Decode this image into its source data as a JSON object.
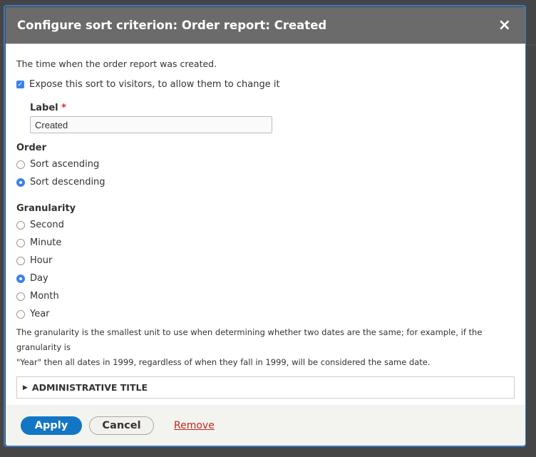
{
  "dialog": {
    "title": "Configure sort criterion: Order report: Created",
    "close_icon": "×",
    "description": "The time when the order report was created.",
    "expose_label": "Expose this sort to visitors, to allow them to change it",
    "expose_checked": true,
    "label_field": {
      "label": "Label",
      "required_mark": "*",
      "value": "Created"
    },
    "order": {
      "label": "Order",
      "options": [
        {
          "label": "Sort ascending",
          "selected": false
        },
        {
          "label": "Sort descending",
          "selected": true
        }
      ]
    },
    "granularity": {
      "label": "Granularity",
      "options": [
        {
          "label": "Second",
          "selected": false
        },
        {
          "label": "Minute",
          "selected": false
        },
        {
          "label": "Hour",
          "selected": false
        },
        {
          "label": "Day",
          "selected": true
        },
        {
          "label": "Month",
          "selected": false
        },
        {
          "label": "Year",
          "selected": false
        }
      ],
      "help_line1": "The granularity is the smallest unit to use when determining whether two dates are the same; for example, if the granularity is",
      "help_line2": "\"Year\" then all dates in 1999, regardless of when they fall in 1999, will be considered the same date."
    },
    "admin_title": "ADMINISTRATIVE TITLE",
    "buttons": {
      "apply": "Apply",
      "cancel": "Cancel",
      "remove": "Remove"
    }
  }
}
